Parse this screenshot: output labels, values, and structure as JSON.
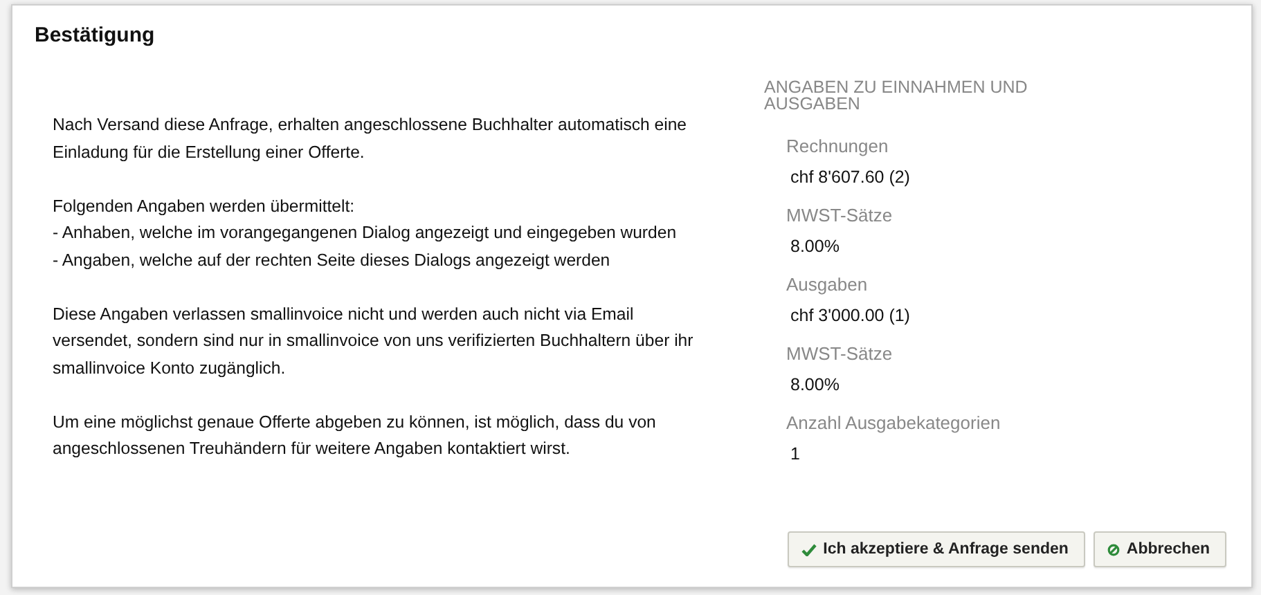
{
  "dialog": {
    "title": "Bestätigung",
    "paragraphs": [
      {
        "kind": "text",
        "text": "Nach Versand diese Anfrage, erhalten angeschlossene Buchhalter automatisch eine Einladung für die Erstellung einer Offerte."
      },
      {
        "kind": "list",
        "text": "Folgenden Angaben werden übermittelt:",
        "items": [
          "- Anhaben, welche im vorangegangenen Dialog angezeigt und eingegeben wurden",
          "- Angaben, welche auf der rechten Seite dieses Dialogs angezeigt werden"
        ]
      },
      {
        "kind": "text",
        "text": "Diese Angaben verlassen smallinvoice nicht und werden auch nicht via Email versendet, sondern sind nur in smallinvoice von uns verifizierten Buchhaltern über ihr smallinvoice Konto zugänglich."
      },
      {
        "kind": "text",
        "text": "Um eine möglichst genaue Offerte abgeben zu können, ist möglich, dass du von angeschlossenen Treuhändern für weitere Angaben kontaktiert wirst."
      }
    ],
    "summary": {
      "heading": "ANGABEN ZU EINNAHMEN UND AUSGABEN",
      "fields": [
        {
          "label": "Rechnungen",
          "value": "chf 8'607.60 (2)"
        },
        {
          "label": "MWST-Sätze",
          "value": "8.00%"
        },
        {
          "label": "Ausgaben",
          "value": "chf 3'000.00 (1)"
        },
        {
          "label": "MWST-Sätze",
          "value": "8.00%"
        },
        {
          "label": "Anzahl Ausgabekategorien",
          "value": "1"
        }
      ]
    },
    "buttons": [
      {
        "kind": "accept",
        "label": "Ich akzeptiere & Anfrage senden"
      },
      {
        "kind": "cancel",
        "label": "Abbrechen"
      }
    ]
  }
}
